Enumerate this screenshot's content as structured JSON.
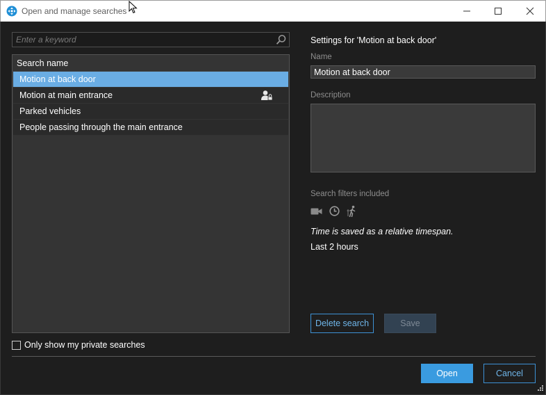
{
  "window": {
    "title": "Open and manage searches",
    "minimize_glyph": "—",
    "maximize_glyph": "☐",
    "close_glyph": "✕"
  },
  "search": {
    "placeholder": "Enter a keyword"
  },
  "list": {
    "header": "Search name",
    "rows": [
      {
        "label": "Motion at back door",
        "selected": true
      },
      {
        "label": "Motion at main entrance",
        "shared": true
      },
      {
        "label": "Parked vehicles"
      },
      {
        "label": "People passing through the main entrance"
      }
    ]
  },
  "private_filter": {
    "label": "Only show my private searches",
    "checked": false
  },
  "settings": {
    "title": "Settings for 'Motion at back door'",
    "name_label": "Name",
    "name_value": "Motion at back door",
    "description_label": "Description",
    "description_value": "",
    "filters_label": "Search filters included",
    "filter_icons": [
      "camera-icon",
      "clock-icon",
      "person-walking-icon"
    ],
    "time_note": "Time is saved as a relative timespan.",
    "timespan": "Last 2 hours"
  },
  "buttons": {
    "delete": "Delete search",
    "save": "Save",
    "open": "Open",
    "cancel": "Cancel"
  },
  "colors": {
    "accent": "#3a9be0",
    "selected_row": "#6aade4",
    "background": "#1e1e1e"
  }
}
